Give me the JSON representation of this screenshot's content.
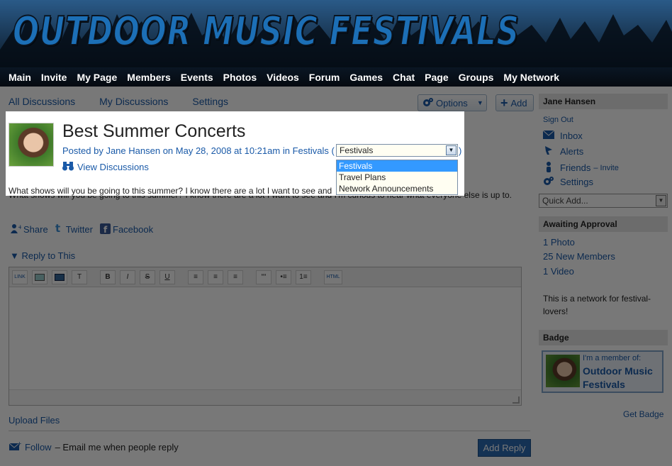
{
  "site": {
    "title": "OUTDOOR MUSIC FESTIVALS",
    "nav": [
      "Main",
      "Invite",
      "My Page",
      "Members",
      "Events",
      "Photos",
      "Videos",
      "Forum",
      "Games",
      "Chat",
      "Page",
      "Groups",
      "My Network"
    ]
  },
  "subnav": {
    "all_discussions": "All Discussions",
    "my_discussions": "My Discussions",
    "settings": "Settings"
  },
  "toolbar": {
    "options_label": "Options",
    "add_label": "Add"
  },
  "discussion": {
    "title": "Best Summer Concerts",
    "posted_by_prefix": "Posted by",
    "author": "Jane Hansen",
    "date_text": "on May 28, 2008 at 10:21am in",
    "category_link": "Festivals",
    "paren_open": "(",
    "paren_close": ")",
    "category_select_value": "Festivals",
    "category_options": [
      "Festivals",
      "Travel Plans",
      "Network Announcements"
    ],
    "view_discussions": "View Discussions",
    "body": "What shows will you be going to this summer? I know there are a lot I want to see and I'm curious to hear what everyone else is up to.",
    "share": "Share",
    "twitter": "Twitter",
    "facebook": "Facebook"
  },
  "reply": {
    "toggle": "▼ Reply to This",
    "editor_buttons": [
      "LINK",
      "IMG",
      "VID",
      "T",
      "B",
      "I",
      "S",
      "U",
      "≡",
      "≡",
      "≡",
      "““",
      "•≡",
      "1≡",
      "HTML"
    ],
    "upload_files": "Upload Files",
    "follow_link": "Follow",
    "follow_text": "– Email me when people reply",
    "add_reply": "Add Reply"
  },
  "sidebar": {
    "user_name": "Jane Hansen",
    "sign_out": "Sign Out",
    "inbox": "Inbox",
    "alerts": "Alerts",
    "friends": "Friends",
    "friends_invite": "– Invite",
    "settings": "Settings",
    "quick_add": "Quick Add...",
    "awaiting_approval": "Awaiting Approval",
    "approval_items": [
      "1 Photo",
      "25 New Members",
      "1 Video"
    ],
    "description": "This is a network for festival-lovers!",
    "badge_heading": "Badge",
    "badge_member_text": "I'm a member of:",
    "badge_network_name": "Outdoor Music Festivals",
    "get_badge": "Get Badge"
  },
  "colors": {
    "link": "#1a5aa8",
    "add_reply_bg": "#2c6bb3",
    "dropdown_selected": "#3399ff",
    "overlay": "rgba(0,0,0,0.53)"
  }
}
